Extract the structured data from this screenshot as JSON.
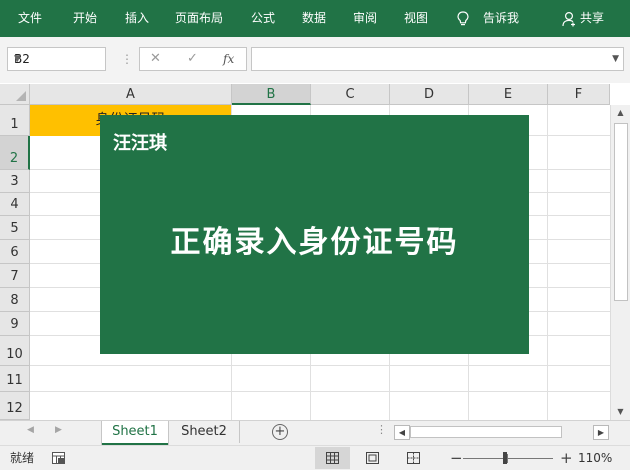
{
  "ribbon": {
    "menu": [
      "文件",
      "开始",
      "插入",
      "页面布局",
      "公式",
      "数据",
      "审阅",
      "视图"
    ],
    "tell_me": "告诉我",
    "share": "共享"
  },
  "formula_bar": {
    "name_box": "B2",
    "cancel_symbol": "✕",
    "enter_symbol": "✓",
    "fx_label": "fx",
    "formula_value": ""
  },
  "columns": [
    "A",
    "B",
    "C",
    "D",
    "E",
    "F"
  ],
  "rows": [
    "1",
    "2",
    "3",
    "4",
    "5",
    "6",
    "7",
    "8",
    "9",
    "10",
    "11",
    "12"
  ],
  "cells": {
    "A1": "身份证号码"
  },
  "overlay": {
    "author": "汪汪琪",
    "title": "正确录入身份证号码"
  },
  "sheets": [
    "Sheet1",
    "Sheet2"
  ],
  "active_sheet": "Sheet1",
  "status": {
    "ready": "就绪",
    "zoom": "110%",
    "zoom_minus": "−",
    "zoom_plus": "+"
  },
  "colors": {
    "accent": "#217346",
    "header_fill": "#ffc000"
  }
}
